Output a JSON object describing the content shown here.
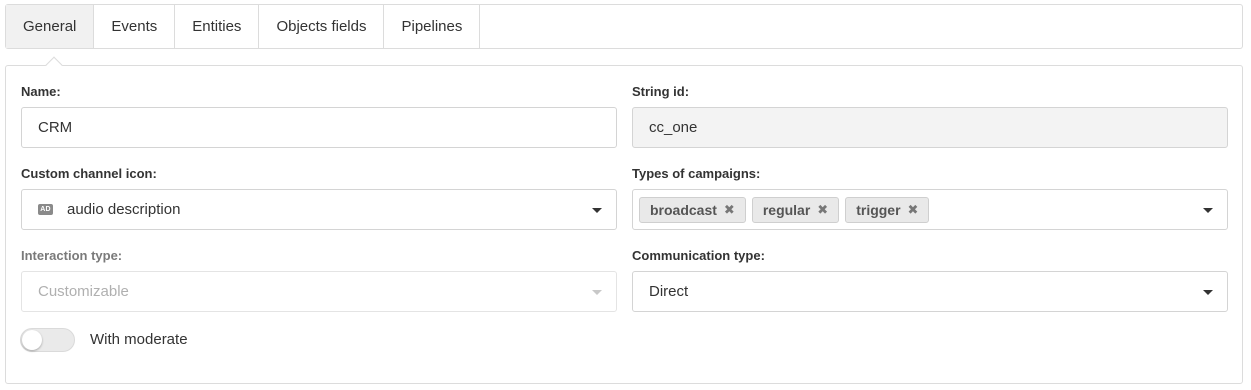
{
  "tabs": [
    {
      "label": "General",
      "active": true
    },
    {
      "label": "Events"
    },
    {
      "label": "Entities"
    },
    {
      "label": "Objects fields"
    },
    {
      "label": "Pipelines"
    }
  ],
  "form": {
    "name": {
      "label": "Name:",
      "value": "CRM"
    },
    "string_id": {
      "label": "String id:",
      "value": "cc_one"
    },
    "custom_channel_icon": {
      "label": "Custom channel icon:",
      "icon": "audio-description-icon",
      "icon_text": "AD",
      "value": "audio description"
    },
    "types_of_campaigns": {
      "label": "Types of campaigns:",
      "tags": [
        "broadcast",
        "regular",
        "trigger"
      ],
      "remove_glyph": "✖"
    },
    "interaction_type": {
      "label": "Interaction type:",
      "value": "Customizable"
    },
    "communication_type": {
      "label": "Communication type:",
      "value": "Direct"
    },
    "with_moderate": {
      "label": "With moderate",
      "checked": false
    }
  }
}
